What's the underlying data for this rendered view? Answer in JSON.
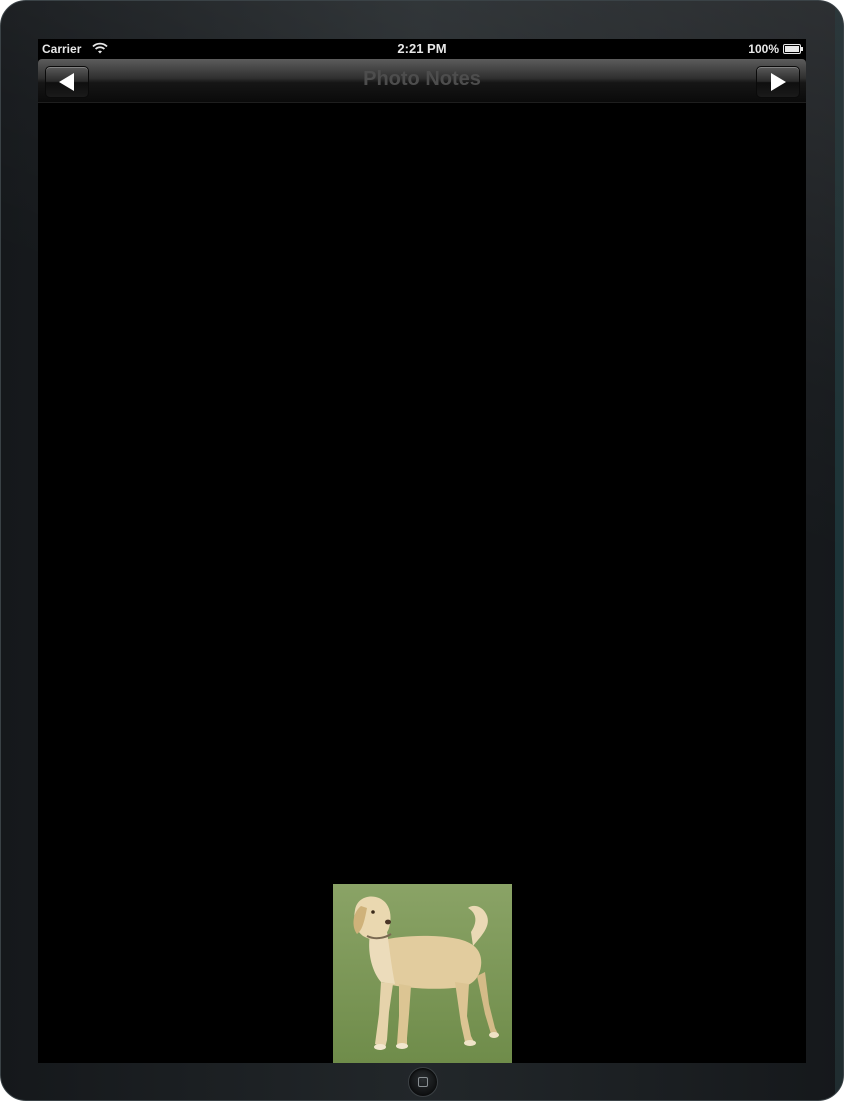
{
  "status_bar": {
    "carrier": "Carrier",
    "time": "2:21 PM",
    "battery": "100%"
  },
  "nav_bar": {
    "title": "Photo Notes",
    "back_icon": "left-arrow-icon",
    "forward_icon": "right-arrow-icon"
  },
  "content": {
    "thumbnail_icon": "dog-photo"
  },
  "colors": {
    "screen_background": "#000000",
    "title_text": "#4d4d4d",
    "grass": "#7e9a59"
  }
}
